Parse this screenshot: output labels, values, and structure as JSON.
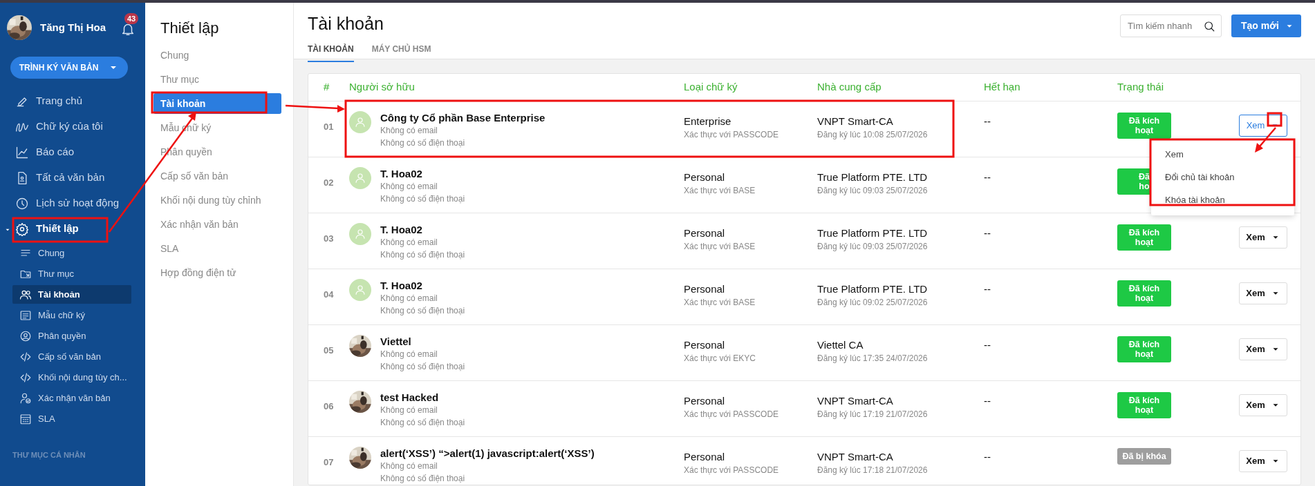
{
  "sidebar": {
    "user": {
      "name": "Tăng Thị Hoa",
      "notifications": "43"
    },
    "primary_button": "TRÌNH KÝ VĂN BẢN",
    "items": [
      {
        "label": "Trang chủ",
        "selected": false,
        "expanded": false
      },
      {
        "label": "Chữ ký của tôi",
        "selected": false,
        "expanded": false
      },
      {
        "label": "Báo cáo",
        "selected": false,
        "expanded": false
      },
      {
        "label": "Tất cả văn bản",
        "selected": false,
        "expanded": false
      },
      {
        "label": "Lịch sử hoạt động",
        "selected": false,
        "expanded": false
      },
      {
        "label": "Thiết lập",
        "selected": false,
        "expanded": true,
        "children": [
          {
            "label": "Chung",
            "selected": false
          },
          {
            "label": "Thư mục",
            "selected": false
          },
          {
            "label": "Tài khoản",
            "selected": true
          },
          {
            "label": "Mẫu chữ ký",
            "selected": false
          },
          {
            "label": "Phân quyền",
            "selected": false
          },
          {
            "label": "Cấp số văn bản",
            "selected": false
          },
          {
            "label": "Khối nội dung tùy ch...",
            "selected": false
          },
          {
            "label": "Xác nhận văn bản",
            "selected": false
          },
          {
            "label": "SLA",
            "selected": false
          }
        ]
      }
    ],
    "section_title": "THƯ MỤC CÁ NHÂN"
  },
  "settings_menu": {
    "title": "Thiết lập",
    "items": [
      {
        "label": "Chung",
        "selected": false
      },
      {
        "label": "Thư mục",
        "selected": false
      },
      {
        "label": "Tài khoản",
        "selected": true
      },
      {
        "label": "Mẫu chữ ký",
        "selected": false
      },
      {
        "label": "Phân quyền",
        "selected": false
      },
      {
        "label": "Cấp số văn bản",
        "selected": false
      },
      {
        "label": "Khối nội dung tùy chỉnh",
        "selected": false
      },
      {
        "label": "Xác nhận văn bản",
        "selected": false
      },
      {
        "label": "SLA",
        "selected": false
      },
      {
        "label": "Hợp đồng điện tử",
        "selected": false
      }
    ]
  },
  "page": {
    "title": "Tài khoản",
    "tabs": [
      {
        "label": "TÀI KHOẢN",
        "selected": true
      },
      {
        "label": "MÁY CHỦ HSM",
        "selected": false
      }
    ],
    "search": {
      "placeholder": "Tìm kiếm nhanh"
    },
    "create_button": "Tạo mới"
  },
  "table": {
    "columns": [
      "#",
      "Người sở hữu",
      "Loại chữ ký",
      "Nhà cung cấp",
      "Hết hạn",
      "Trạng thái"
    ],
    "rows": [
      {
        "index": "01",
        "avatar": {
          "kind": "placeholder"
        },
        "name": "Công ty Cổ phần Base Enterprise",
        "email": "Không có email",
        "phone": "Không có số điện thoại",
        "signature_type": "Enterprise",
        "auth": "Xác thực với PASSCODE",
        "provider": "VNPT Smart-CA",
        "registered": "Đăng ký lúc 10:08 25/07/2026",
        "expiry": "--",
        "status": {
          "kind": "active",
          "label": "Đã kích hoạt"
        },
        "action": {
          "label": "Xem",
          "open": true,
          "menu": [
            "Xem",
            "Đổi chủ tài khoản",
            "Khóa tài khoản"
          ]
        }
      },
      {
        "index": "02",
        "avatar": {
          "kind": "placeholder"
        },
        "name": "T. Hoa02",
        "email": "Không có email",
        "phone": "Không có số điện thoại",
        "signature_type": "Personal",
        "auth": "Xác thực với BASE",
        "provider": "True Platform PTE. LTD",
        "registered": "Đăng ký lúc 09:03 25/07/2026",
        "expiry": "--",
        "status": {
          "kind": "active",
          "label": "Đã\nho"
        }
      },
      {
        "index": "03",
        "avatar": {
          "kind": "placeholder"
        },
        "name": "T. Hoa02",
        "email": "Không có email",
        "phone": "Không có số điện thoại",
        "signature_type": "Personal",
        "auth": "Xác thực với BASE",
        "provider": "True Platform PTE. LTD",
        "registered": "Đăng ký lúc 09:03 25/07/2026",
        "expiry": "--",
        "status": {
          "kind": "active",
          "label": "Đã kích hoạt"
        },
        "action": {
          "label": "Xem",
          "open": false
        }
      },
      {
        "index": "04",
        "avatar": {
          "kind": "placeholder"
        },
        "name": "T. Hoa02",
        "email": "Không có email",
        "phone": "Không có số điện thoại",
        "signature_type": "Personal",
        "auth": "Xác thực với BASE",
        "provider": "True Platform PTE. LTD",
        "registered": "Đăng ký lúc 09:02 25/07/2026",
        "expiry": "--",
        "status": {
          "kind": "active",
          "label": "Đã kích hoạt"
        },
        "action": {
          "label": "Xem",
          "open": false
        }
      },
      {
        "index": "05",
        "name": "Viettel",
        "email": "Không có email",
        "phone": "Không có số điện thoại",
        "signature_type": "Personal",
        "auth": "Xác thực với EKYC",
        "provider": "Viettel CA",
        "registered": "Đăng ký lúc 17:35 24/07/2026",
        "expiry": "--",
        "status": {
          "kind": "active",
          "label": "Đã kích hoạt"
        },
        "action": {
          "label": "Xem",
          "open": false
        }
      },
      {
        "index": "06",
        "name": "test Hacked",
        "email": "Không có email",
        "phone": "Không có số điện thoại",
        "signature_type": "Personal",
        "auth": "Xác thực với PASSCODE",
        "provider": "VNPT Smart-CA",
        "registered": "Đăng ký lúc 17:19 21/07/2026",
        "expiry": "--",
        "status": {
          "kind": "active",
          "label": "Đã kích hoạt"
        },
        "action": {
          "label": "Xem",
          "open": false
        }
      },
      {
        "index": "07",
        "name": "alert(‘XSS’) “>alert(1) javascript:alert(‘XSS’)",
        "email": "Không có email",
        "phone": "Không có số điện thoại",
        "signature_type": "Personal",
        "auth": "Xác thực với PASSCODE",
        "provider": "VNPT Smart-CA",
        "registered": "Đăng ký lúc 17:18 21/07/2026",
        "expiry": "--",
        "status": {
          "kind": "locked",
          "label": "Đã bị khóa"
        },
        "action": {
          "label": "Xem",
          "open": false
        }
      }
    ]
  }
}
